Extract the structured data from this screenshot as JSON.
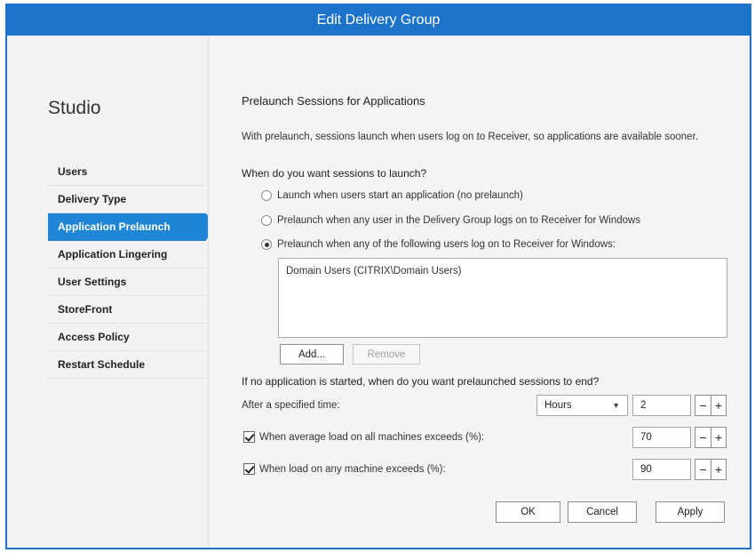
{
  "window": {
    "title": "Edit Delivery Group"
  },
  "sidebar": {
    "app_name": "Studio",
    "items": [
      {
        "label": "Users",
        "active": false
      },
      {
        "label": "Delivery Type",
        "active": false
      },
      {
        "label": "Application Prelaunch",
        "active": true
      },
      {
        "label": "Application Lingering",
        "active": false
      },
      {
        "label": "User Settings",
        "active": false
      },
      {
        "label": "StoreFront",
        "active": false
      },
      {
        "label": "Access Policy",
        "active": false
      },
      {
        "label": "Restart Schedule",
        "active": false
      }
    ]
  },
  "main": {
    "heading": "Prelaunch Sessions for Applications",
    "description": "With prelaunch, sessions launch when users log on to Receiver, so applications are available sooner.",
    "launch_question": "When do you want sessions to launch?",
    "radio_options": [
      {
        "label": "Launch when users start an application (no prelaunch)",
        "selected": false
      },
      {
        "label": "Prelaunch when any user in the Delivery Group logs on to Receiver for Windows",
        "selected": false
      },
      {
        "label": "Prelaunch when any of the following users log on to Receiver for Windows:",
        "selected": true
      }
    ],
    "user_list": [
      "Domain Users (CITRIX\\Domain Users)"
    ],
    "add_button": "Add...",
    "remove_button": "Remove",
    "end_question": "If no application is started, when do you want prelaunched sessions to end?",
    "after_time": {
      "label": "After a specified time:",
      "unit": "Hours",
      "value": "2"
    },
    "avg_load": {
      "label": "When average load on all machines exceeds (%):",
      "checked": true,
      "value": "70"
    },
    "any_load": {
      "label": "When load on any machine exceeds (%):",
      "checked": true,
      "value": "90"
    },
    "minus": "−",
    "plus": "+"
  },
  "footer": {
    "ok": "OK",
    "cancel": "Cancel",
    "apply": "Apply"
  },
  "colors": {
    "accent": "#1d73c9",
    "nav_active": "#1f86d6"
  }
}
